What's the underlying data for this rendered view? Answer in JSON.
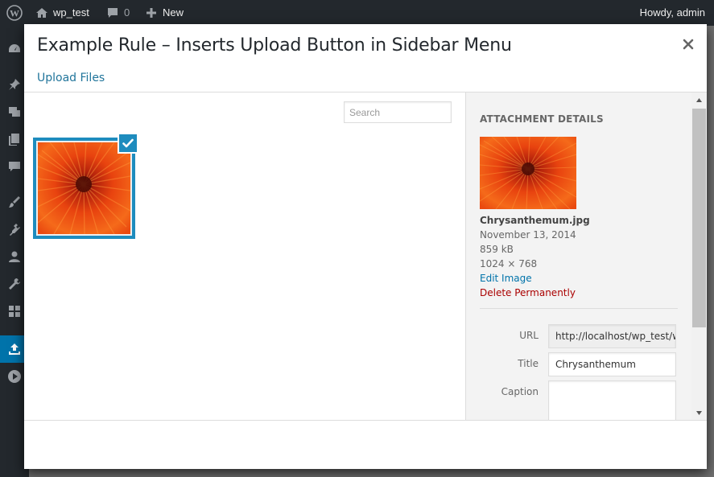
{
  "adminbar": {
    "site_name": "wp_test",
    "comments_count": "0",
    "new_label": "New",
    "greeting": "Howdy, admin"
  },
  "modal": {
    "title": "Example Rule – Inserts Upload Button in Sidebar Menu",
    "upload_link": "Upload Files",
    "search_placeholder": "Search"
  },
  "attachment": {
    "heading": "ATTACHMENT DETAILS",
    "filename": "Chrysanthemum.jpg",
    "uploaded": "November 13, 2014",
    "filesize": "859 kB",
    "dimensions": "1024 × 768",
    "edit_label": "Edit Image",
    "delete_label": "Delete Permanently",
    "fields": {
      "url_label": "URL",
      "url_value": "http://localhost/wp_test/w",
      "title_label": "Title",
      "title_value": "Chrysanthemum",
      "caption_label": "Caption"
    }
  },
  "colors": {
    "accent": "#1e8cbe",
    "link": "#0073aa",
    "danger": "#a00",
    "adminbar": "#23282d"
  }
}
